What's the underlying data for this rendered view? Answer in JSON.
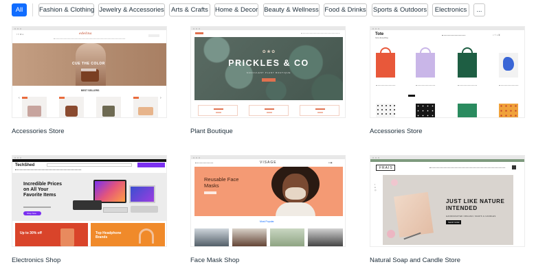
{
  "filters": [
    {
      "label": "All",
      "active": true
    },
    {
      "label": "Fashion & Clothing"
    },
    {
      "label": "Jewelry & Accessories"
    },
    {
      "label": "Arts & Crafts"
    },
    {
      "label": "Home & Decor"
    },
    {
      "label": "Beauty & Wellness"
    },
    {
      "label": "Food & Drinks"
    },
    {
      "label": "Sports & Outdoors"
    },
    {
      "label": "Electronics"
    },
    {
      "label": "..."
    }
  ],
  "templates": [
    {
      "caption": "Accessories Store",
      "preview": {
        "logo": "edelina",
        "hero_text": "CUE THE COLOR",
        "section_title": "BEST SELLERS",
        "colors": {
          "hero": "#b58f73",
          "bag1": "#c7a49e",
          "bag2": "#8a4a2f",
          "bag3": "#6e6a52",
          "bag4": "#e7b48b",
          "badge": "#e96c3d"
        }
      }
    },
    {
      "caption": "Plant Boutique",
      "preview": {
        "brand": "PRICKLES & CO",
        "brand_sub": "SUCCULENT PLANT BOUTIQUE",
        "colors": {
          "hero": "#5a6b63",
          "accent": "#e0714f",
          "leaf": "#3f5c55"
        }
      }
    },
    {
      "caption": "Accessories Store",
      "preview": {
        "logo": "Tote",
        "tagline": "Carry Everything",
        "colors": {
          "tote1": "#e8583a",
          "tote2": "#c9b6e8",
          "tote3": "#1e5e43",
          "tote4": "#3a66d6",
          "tote5": "#f2f2f2",
          "tote6": "#171717",
          "tote7": "#2a8b5f",
          "tote8": "#f0a23b"
        }
      }
    },
    {
      "caption": "Electronics Shop",
      "preview": {
        "logo": "TechShed",
        "hero_title": "Incredible Prices on All Your Favorite Items",
        "button": "Shop Now",
        "promo1": "Up to 30% off",
        "promo2": "Top Headphone Brands",
        "colors": {
          "hero": "#ececec",
          "accent": "#7b30f0",
          "promo1": "#d9442a",
          "promo2": "#f08a2a"
        }
      }
    },
    {
      "caption": "Face Mask Shop",
      "preview": {
        "logo": "VISAGE",
        "hero_title": "Reusable Face Masks",
        "section_title": "Most Popular",
        "colors": {
          "hero": "#f49a74",
          "skin": "#7a4a32",
          "hair": "#2a1a12"
        }
      }
    },
    {
      "caption": "Natural Soap and Candle Store",
      "preview": {
        "logo": "FRAIS",
        "hero_title": "JUST LIKE NATURE INTENDED",
        "hero_sub": "HANDCRAFTED ORGANIC SOAPS & CANDLES",
        "button": "SHOP NOW",
        "colors": {
          "bar": "#7e9a7e",
          "hero": "#d9d4cf",
          "soap": "#e9cbb6"
        }
      }
    }
  ]
}
